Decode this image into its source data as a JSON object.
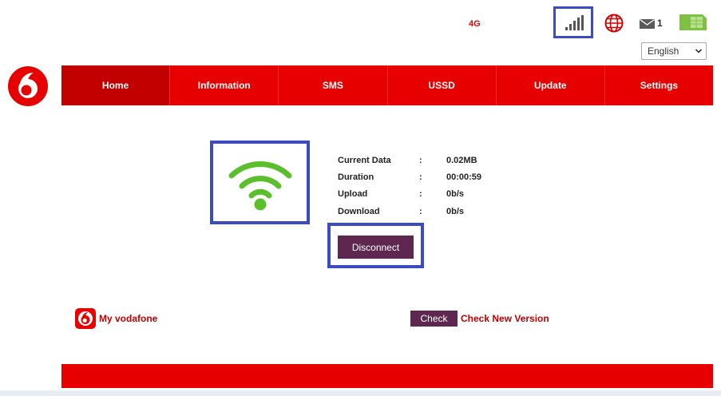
{
  "status": {
    "network_type": "4G",
    "message_count": "1",
    "signal_bars": 4
  },
  "language": {
    "selected": "English"
  },
  "nav": {
    "items": [
      "Home",
      "Information",
      "SMS",
      "USSD",
      "Update",
      "Settings"
    ],
    "active": "Home"
  },
  "connection": {
    "stats": [
      {
        "label": "Current Data",
        "value": "0.02MB"
      },
      {
        "label": "Duration",
        "value": "00:00:59"
      },
      {
        "label": "Upload",
        "value": "0b/s"
      },
      {
        "label": "Download",
        "value": "0b/s"
      }
    ],
    "separator": ":",
    "disconnect_label": "Disconnect"
  },
  "links": {
    "my_vodafone": "My vodafone",
    "check_button": "Check",
    "check_new_version": "Check New Version"
  },
  "icons": [
    "signal-icon",
    "globe-icon",
    "mail-icon",
    "sim-card-icon",
    "vodafone-logo",
    "wifi-icon"
  ],
  "colors": {
    "brand_red": "#e60000",
    "active_nav": "#c20000",
    "button_purple": "#5e2750",
    "wifi_green": "#5bbf2b",
    "highlight_blue": "#3c4bbf",
    "link_red": "#c00000"
  }
}
